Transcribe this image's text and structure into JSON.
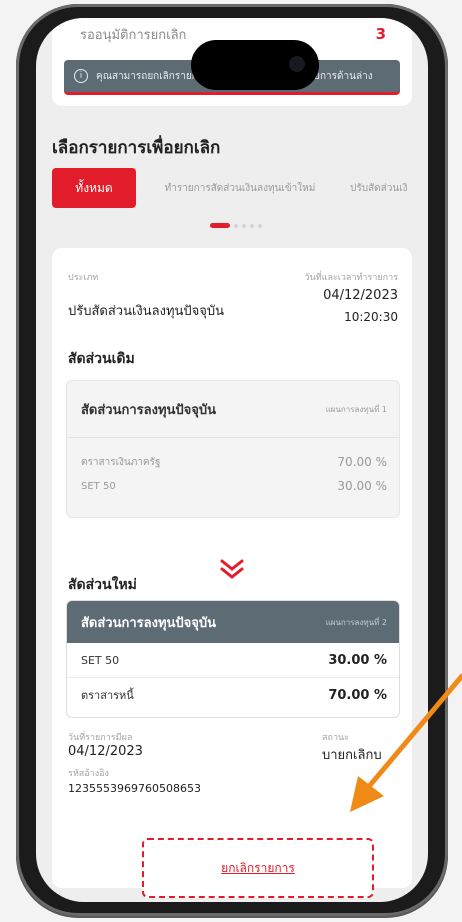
{
  "summary": {
    "label": "รออนุมัติการยกเลิก",
    "count": "3",
    "notice": "คุณสามารถยกเลิกรายการที่รอดำเนินการได้ตามรายการด้านล่าง"
  },
  "section_title": "เลือกรายการเพื่อยกเลิก",
  "chips": [
    {
      "label": "ทั้งหมด"
    },
    {
      "label": "ทำรายการสัดส่วนเงินลงทุนเข้าใหม่"
    },
    {
      "label": "ปรับสัดส่วนเงิ"
    }
  ],
  "detail": {
    "type_label": "ประเภท",
    "type_value": "ปรับสัดส่วนเงินลงทุนปัจจุบัน",
    "datetime_label": "วันที่และเวลาทำรายการ",
    "date": "04/12/2023",
    "time": "10:20:30",
    "old_title": "สัดส่วนเดิม",
    "old_box": {
      "header": "สัดส่วนการลงทุนปัจจุบัน",
      "plan": "แผนการลงทุนที่ 1",
      "rows": [
        {
          "name": "ตราสารเงินภาครัฐ",
          "pct": "70.00 %"
        },
        {
          "name": "SET 50",
          "pct": "30.00 %"
        }
      ]
    },
    "new_title": "สัดส่วนใหม่",
    "new_box": {
      "header": "สัดส่วนการลงทุนปัจจุบัน",
      "plan": "แผนการลงทุนที่ 2",
      "rows": [
        {
          "name": "SET 50",
          "pct": "30.00 %"
        },
        {
          "name": "ตราสารหนี้",
          "pct": "70.00 %"
        }
      ]
    },
    "effective_label": "วันที่รายการมีผล",
    "effective_date": "04/12/2023",
    "status_label": "สถานะ",
    "status_value": "บายกเลิกบ",
    "ref_label": "รหัสอ้างอิง",
    "ref_value": "1235553969760508653",
    "cancel_label": "ยกเลิกรายการ"
  },
  "colors": {
    "accent": "#e31c2b",
    "header_gray": "#5d6b74",
    "arrow": "#ef8a17"
  }
}
